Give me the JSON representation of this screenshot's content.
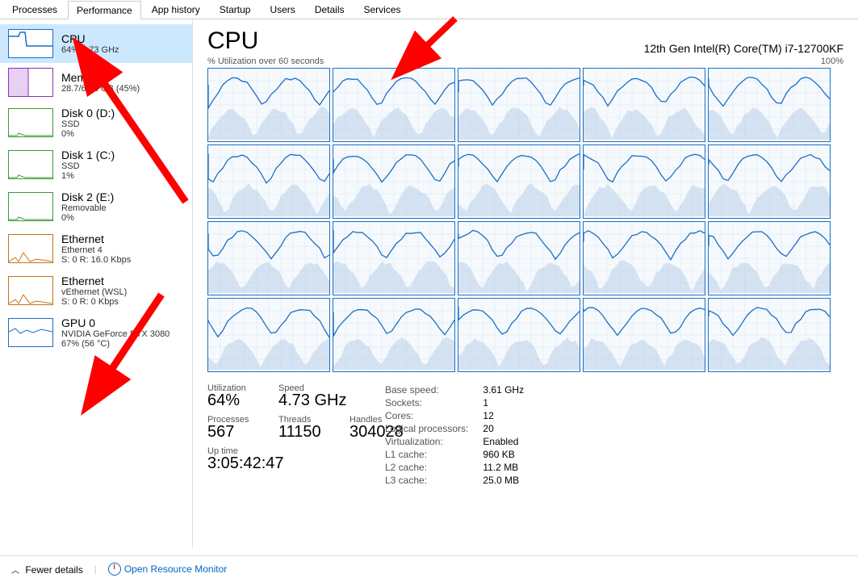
{
  "tabs": [
    "Processes",
    "Performance",
    "App history",
    "Startup",
    "Users",
    "Details",
    "Services"
  ],
  "active_tab": 1,
  "sidebar": [
    {
      "title": "CPU",
      "l1": "64%  4.73 GHz",
      "l2": "",
      "kind": "cpu",
      "selected": true
    },
    {
      "title": "Memory",
      "l1": "28.7/63.8 GB (45%)",
      "l2": "",
      "kind": "mem"
    },
    {
      "title": "Disk 0 (D:)",
      "l1": "SSD",
      "l2": "0%",
      "kind": "disk"
    },
    {
      "title": "Disk 1 (C:)",
      "l1": "SSD",
      "l2": "1%",
      "kind": "disk"
    },
    {
      "title": "Disk 2 (E:)",
      "l1": "Removable",
      "l2": "0%",
      "kind": "disk"
    },
    {
      "title": "Ethernet",
      "l1": "Ethernet 4",
      "l2": "S: 0 R: 16.0 Kbps",
      "kind": "eth"
    },
    {
      "title": "Ethernet",
      "l1": "vEthernet (WSL)",
      "l2": "S: 0 R: 0 Kbps",
      "kind": "eth"
    },
    {
      "title": "GPU 0",
      "l1": "NVIDIA GeForce RTX 3080",
      "l2": "67%  (56 °C)",
      "kind": "gpu"
    }
  ],
  "header": {
    "title": "CPU",
    "model": "12th Gen Intel(R) Core(TM) i7-12700KF"
  },
  "graph_label_left": "% Utilization over 60 seconds",
  "graph_label_right": "100%",
  "stats": {
    "utilization_label": "Utilization",
    "utilization": "64%",
    "speed_label": "Speed",
    "speed": "4.73 GHz",
    "processes_label": "Processes",
    "processes": "567",
    "threads_label": "Threads",
    "threads": "11150",
    "handles_label": "Handles",
    "handles": "304028",
    "uptime_label": "Up time",
    "uptime": "3:05:42:47"
  },
  "details": [
    [
      "Base speed:",
      "3.61 GHz"
    ],
    [
      "Sockets:",
      "1"
    ],
    [
      "Cores:",
      "12"
    ],
    [
      "Logical processors:",
      "20"
    ],
    [
      "Virtualization:",
      "Enabled"
    ],
    [
      "L1 cache:",
      "960 KB"
    ],
    [
      "L2 cache:",
      "11.2 MB"
    ],
    [
      "L3 cache:",
      "25.0 MB"
    ]
  ],
  "footer": {
    "fewer": "Fewer details",
    "monitor": "Open Resource Monitor"
  }
}
